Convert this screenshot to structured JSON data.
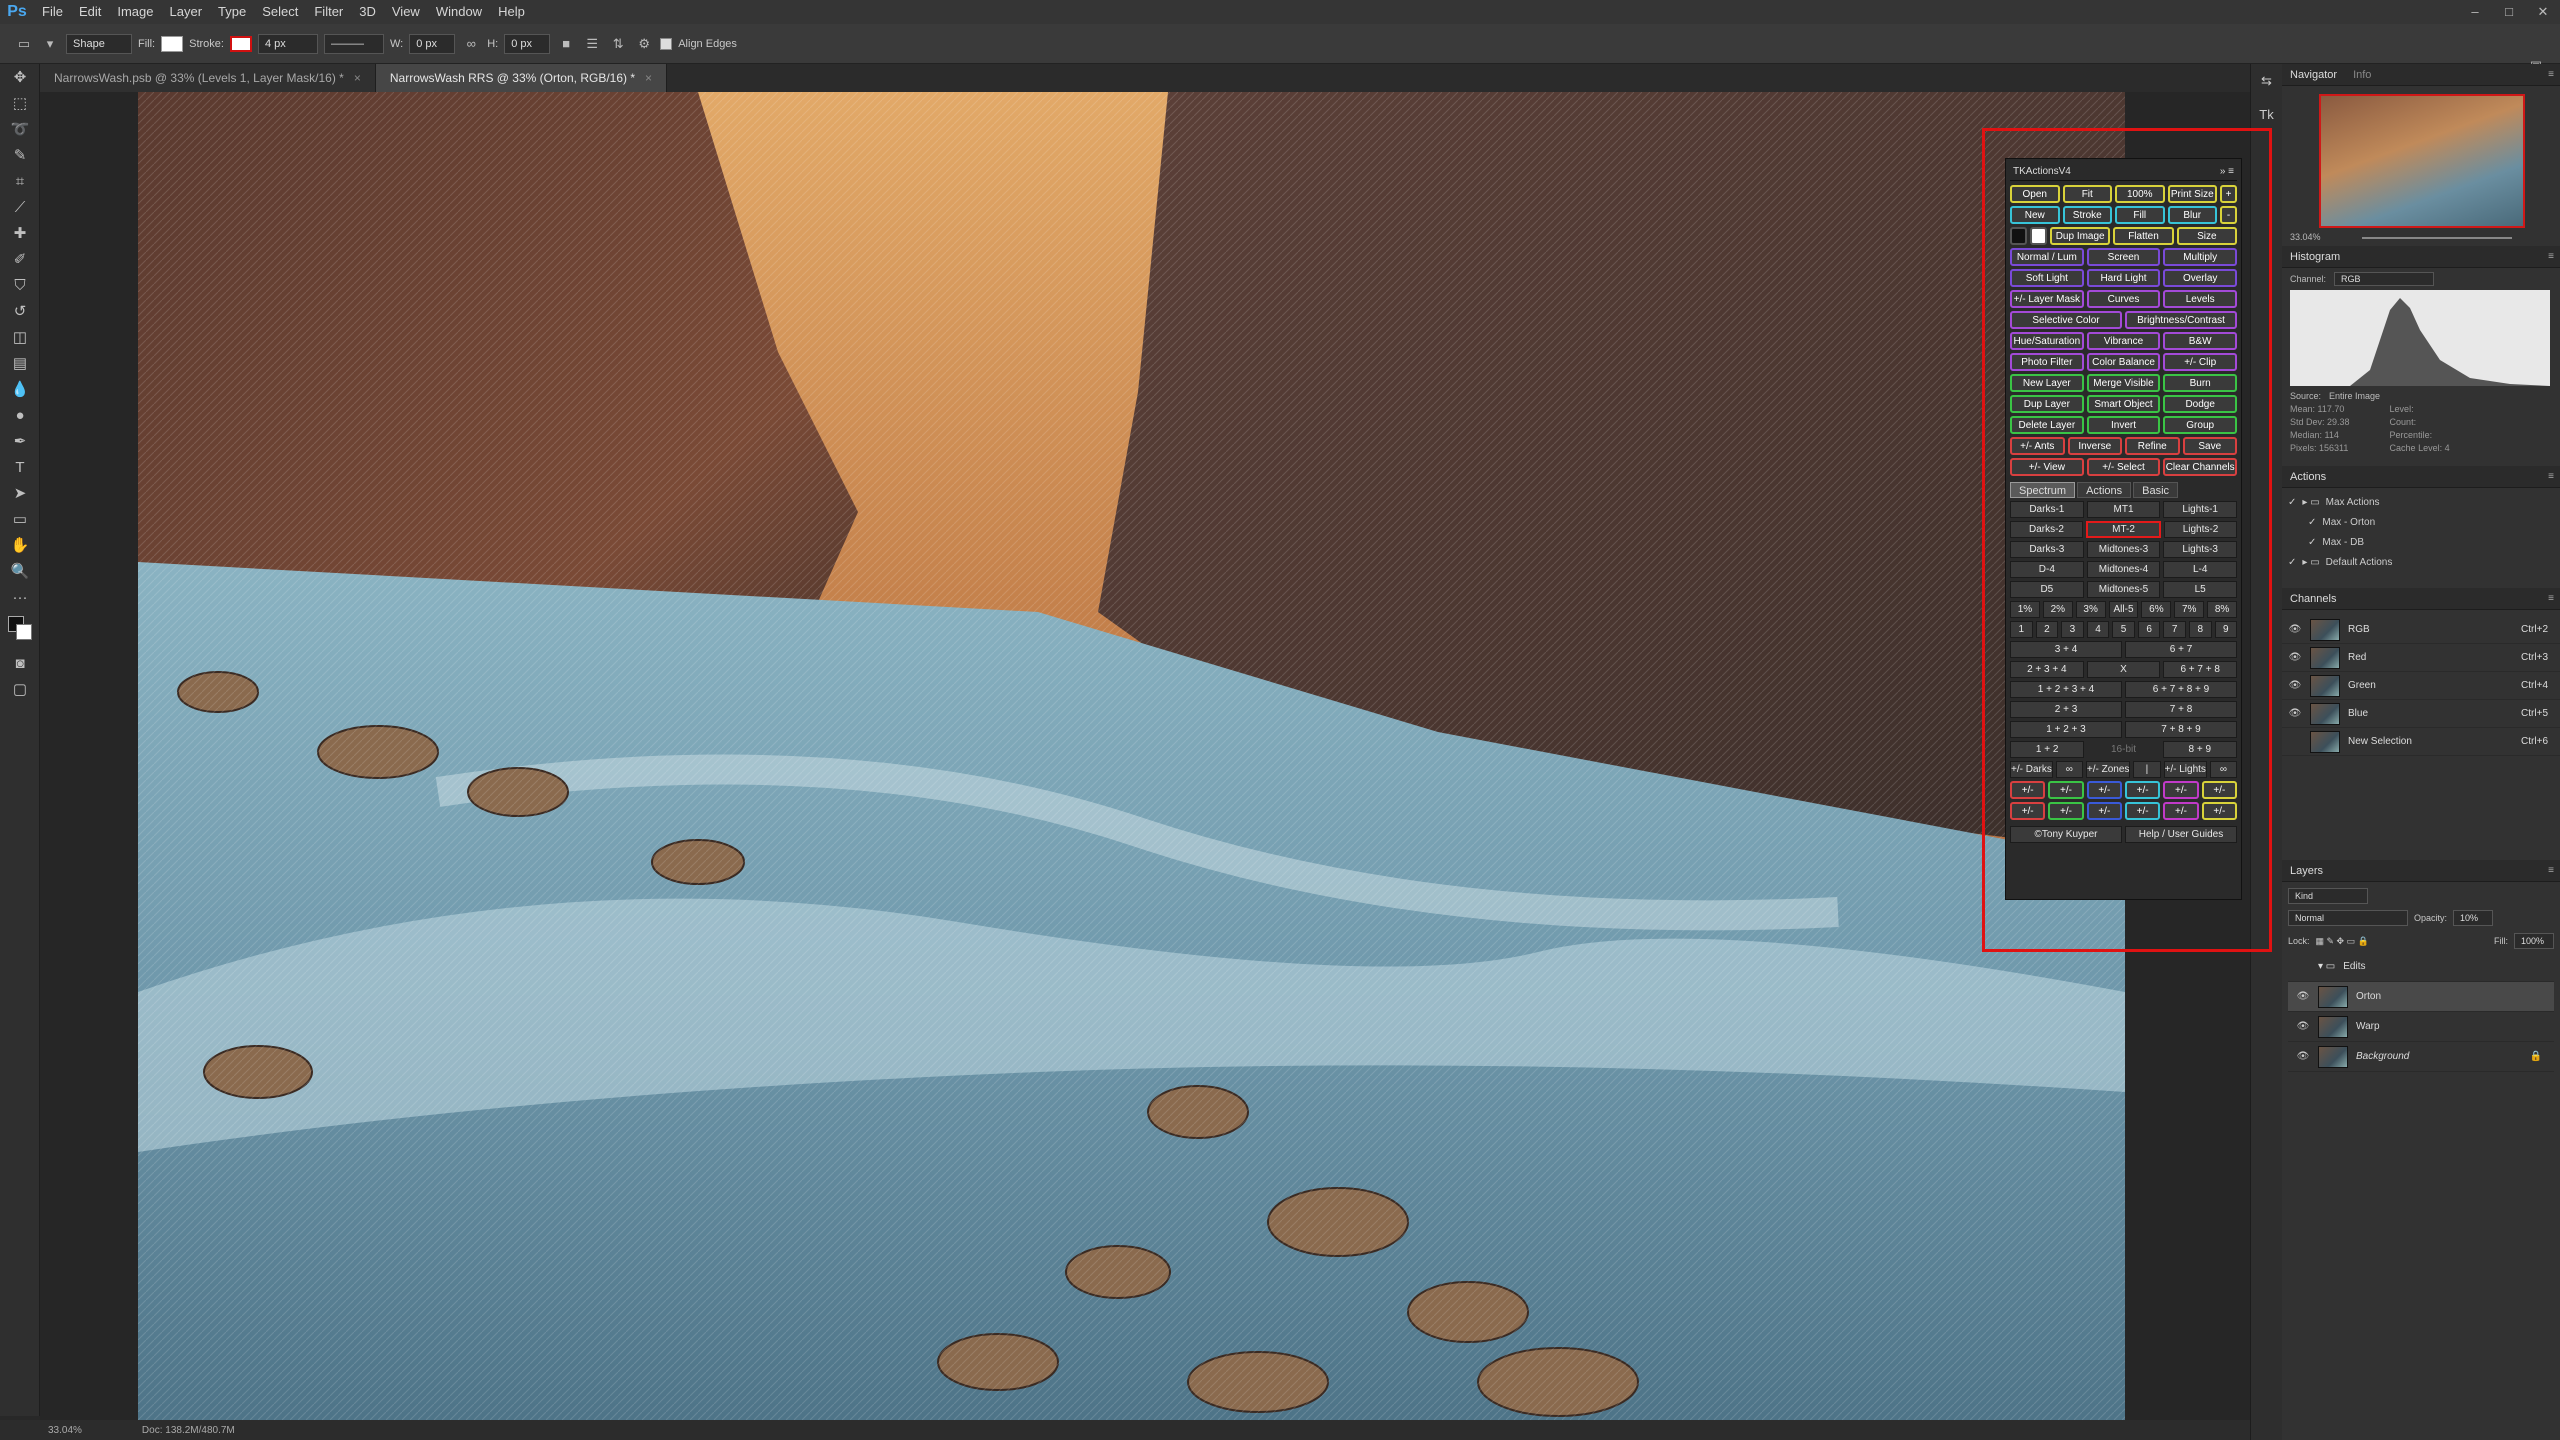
{
  "menu": {
    "logo": "Ps",
    "items": [
      "File",
      "Edit",
      "Image",
      "Layer",
      "Type",
      "Select",
      "Filter",
      "3D",
      "View",
      "Window",
      "Help"
    ]
  },
  "window_controls": [
    "–",
    "□",
    "✕"
  ],
  "options": {
    "tool_preset": "Shape",
    "fill_label": "Fill:",
    "stroke_label": "Stroke:",
    "stroke_width": "4 px",
    "w_label": "W:",
    "w_value": "0 px",
    "h_label": "H:",
    "h_value": "0 px",
    "align_edges": "Align Edges"
  },
  "tabs": [
    {
      "label": "NarrowsWash.psb @ 33% (Levels 1, Layer Mask/16) *",
      "close": "×"
    },
    {
      "label": "NarrowsWash RRS @ 33% (Orton, RGB/16) *",
      "close": "×"
    }
  ],
  "status": {
    "zoom": "33.04%",
    "doc": "Doc: 138.2M/480.7M"
  },
  "tk": {
    "title": "TKActionsV4",
    "rows1": [
      [
        {
          "t": "Open",
          "c": "y"
        },
        {
          "t": "Fit",
          "c": "y"
        },
        {
          "t": "100%",
          "c": "y"
        },
        {
          "t": "Print Size",
          "c": "y"
        },
        {
          "t": "+",
          "c": "y",
          "s": 1
        }
      ],
      [
        {
          "t": "New",
          "c": "c"
        },
        {
          "t": "Stroke",
          "c": "c"
        },
        {
          "t": "Fill",
          "c": "c"
        },
        {
          "t": "Blur",
          "c": "c"
        },
        {
          "t": "-",
          "c": "y",
          "s": 1
        }
      ],
      [
        {
          "t": "Dup Image",
          "c": "y"
        },
        {
          "t": "Flatten",
          "c": "y"
        },
        {
          "t": "Size",
          "c": "y"
        }
      ],
      [
        {
          "t": "Normal / Lum",
          "c": "p"
        },
        {
          "t": "Screen",
          "c": "p"
        },
        {
          "t": "Multiply",
          "c": "p"
        }
      ],
      [
        {
          "t": "Soft Light",
          "c": "p"
        },
        {
          "t": "Hard Light",
          "c": "p"
        },
        {
          "t": "Overlay",
          "c": "p"
        }
      ],
      [
        {
          "t": "+/- Layer Mask",
          "c": "v"
        },
        {
          "t": "Curves",
          "c": "v"
        },
        {
          "t": "Levels",
          "c": "v"
        }
      ],
      [
        {
          "t": "Selective Color",
          "c": "v"
        },
        {
          "t": "Brightness/Contrast",
          "c": "v"
        }
      ],
      [
        {
          "t": "Hue/Saturation",
          "c": "v"
        },
        {
          "t": "Vibrance",
          "c": "v"
        },
        {
          "t": "B&W",
          "c": "v"
        }
      ],
      [
        {
          "t": "Photo Filter",
          "c": "v"
        },
        {
          "t": "Color Balance",
          "c": "v"
        },
        {
          "t": "+/- Clip",
          "c": "v"
        }
      ],
      [
        {
          "t": "New Layer",
          "c": "g"
        },
        {
          "t": "Merge Visible",
          "c": "g"
        },
        {
          "t": "Burn",
          "c": "g"
        }
      ],
      [
        {
          "t": "Dup Layer",
          "c": "g"
        },
        {
          "t": "Smart Object",
          "c": "g"
        },
        {
          "t": "Dodge",
          "c": "g"
        }
      ],
      [
        {
          "t": "Delete Layer",
          "c": "g"
        },
        {
          "t": "Invert",
          "c": "g"
        },
        {
          "t": "Group",
          "c": "g"
        }
      ],
      [
        {
          "t": "+/- Ants",
          "c": "r"
        },
        {
          "t": "Inverse",
          "c": "r"
        },
        {
          "t": "Refine",
          "c": "r"
        },
        {
          "t": "Save",
          "c": "r"
        }
      ],
      [
        {
          "t": "+/- View",
          "c": "r"
        },
        {
          "t": "+/- Select",
          "c": "r"
        },
        {
          "t": "Clear Channels",
          "c": "r"
        }
      ]
    ],
    "subtabs": [
      "Spectrum",
      "Actions",
      "Basic"
    ],
    "rows2": [
      [
        "Darks-1",
        "MT1",
        "Lights-1"
      ],
      [
        "Darks-2",
        "MT-2",
        "Lights-2"
      ],
      [
        "Darks-3",
        "Midtones-3",
        "Lights-3"
      ],
      [
        "D-4",
        "Midtones-4",
        "L-4"
      ],
      [
        "D5",
        "Midtones-5",
        "L5"
      ],
      [
        "1%",
        "2%",
        "3%",
        "All-5",
        "6%",
        "7%",
        "8%"
      ],
      [
        "1",
        "2",
        "3",
        "4",
        "5",
        "6",
        "7",
        "8",
        "9"
      ],
      [
        "3 + 4",
        "6 + 7"
      ],
      [
        "2 + 3 + 4",
        "X",
        "6 + 7 + 8"
      ],
      [
        "1 + 2 + 3 + 4",
        "6 + 7 + 8 + 9"
      ],
      [
        "2 + 3",
        "7 + 8"
      ],
      [
        "1 + 2 + 3",
        "7 + 8 + 9"
      ],
      [
        "1 + 2",
        "16-bit",
        "8 + 9"
      ]
    ],
    "zones_row": [
      "+/- Darks",
      "∞",
      "+/- Zones",
      "|",
      "+/- Lights",
      "∞"
    ],
    "pm_row1": [
      "+/-",
      "+/-",
      "+/-",
      "+/-",
      "+/-",
      "+/-"
    ],
    "pm_row2": [
      "+/-",
      "+/-",
      "+/-",
      "+/-",
      "+/-",
      "+/-"
    ],
    "footer": [
      "©Tony Kuyper",
      "Help / User Guides"
    ]
  },
  "navigator": {
    "tabs": [
      "Navigator",
      "Info"
    ],
    "zoom": "33.04%"
  },
  "histogram": {
    "title": "Histogram",
    "channel_label": "Channel:",
    "channel": "RGB",
    "source_label": "Source:",
    "source": "Entire Image",
    "stats_left": [
      "Mean: 117.70",
      "Std Dev: 29.38",
      "Median: 114",
      "Pixels: 156311"
    ],
    "stats_right": [
      "Level:",
      "Count:",
      "Percentile:",
      "Cache Level: 4"
    ]
  },
  "actions": {
    "title": "Actions",
    "items": [
      "Max Actions",
      "Max - Orton",
      "Max - DB",
      "Default Actions"
    ]
  },
  "channels": {
    "title": "Channels",
    "items": [
      {
        "name": "RGB",
        "key": "Ctrl+2"
      },
      {
        "name": "Red",
        "key": "Ctrl+3"
      },
      {
        "name": "Green",
        "key": "Ctrl+4"
      },
      {
        "name": "Blue",
        "key": "Ctrl+5"
      },
      {
        "name": "New Selection",
        "key": "Ctrl+6"
      }
    ]
  },
  "layers": {
    "title": "Layers",
    "kind": "Kind",
    "blend": "Normal",
    "opacity_label": "Opacity:",
    "opacity": "10%",
    "lock_label": "Lock:",
    "fill_label": "Fill:",
    "fill": "100%",
    "items": [
      {
        "name": "Edits",
        "group": true
      },
      {
        "name": "Orton"
      },
      {
        "name": "Warp"
      },
      {
        "name": "Background",
        "locked": true
      }
    ]
  }
}
